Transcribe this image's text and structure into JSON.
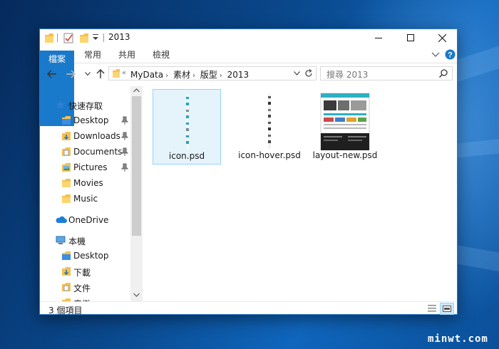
{
  "window": {
    "title": "2013"
  },
  "ribbon": {
    "tabs": [
      "檔案",
      "常用",
      "共用",
      "檢視"
    ]
  },
  "address": {
    "crumbs": [
      "MyData",
      "素材",
      "版型",
      "2013"
    ]
  },
  "search": {
    "placeholder": "搜尋 2013"
  },
  "nav": {
    "quick_access": "快速存取",
    "items": [
      {
        "label": "Desktop",
        "pinned": true
      },
      {
        "label": "Downloads",
        "pinned": true
      },
      {
        "label": "Documents",
        "pinned": true
      },
      {
        "label": "Pictures",
        "pinned": true
      },
      {
        "label": "Movies",
        "pinned": false
      },
      {
        "label": "Music",
        "pinned": false
      }
    ],
    "onedrive": "OneDrive",
    "this_pc": "本機",
    "pc_items": [
      "Desktop",
      "下載",
      "文件",
      "音樂"
    ]
  },
  "files": [
    {
      "name": "icon.psd",
      "selected": true
    },
    {
      "name": "icon-hover.psd",
      "selected": false
    },
    {
      "name": "layout-new.psd",
      "selected": false
    }
  ],
  "status": {
    "item_count": "3 個項目"
  },
  "watermark": "minwt.com",
  "colors": {
    "accent": "#1979ca",
    "folder": "#f5c14d",
    "selection": "#e5f3fb"
  }
}
